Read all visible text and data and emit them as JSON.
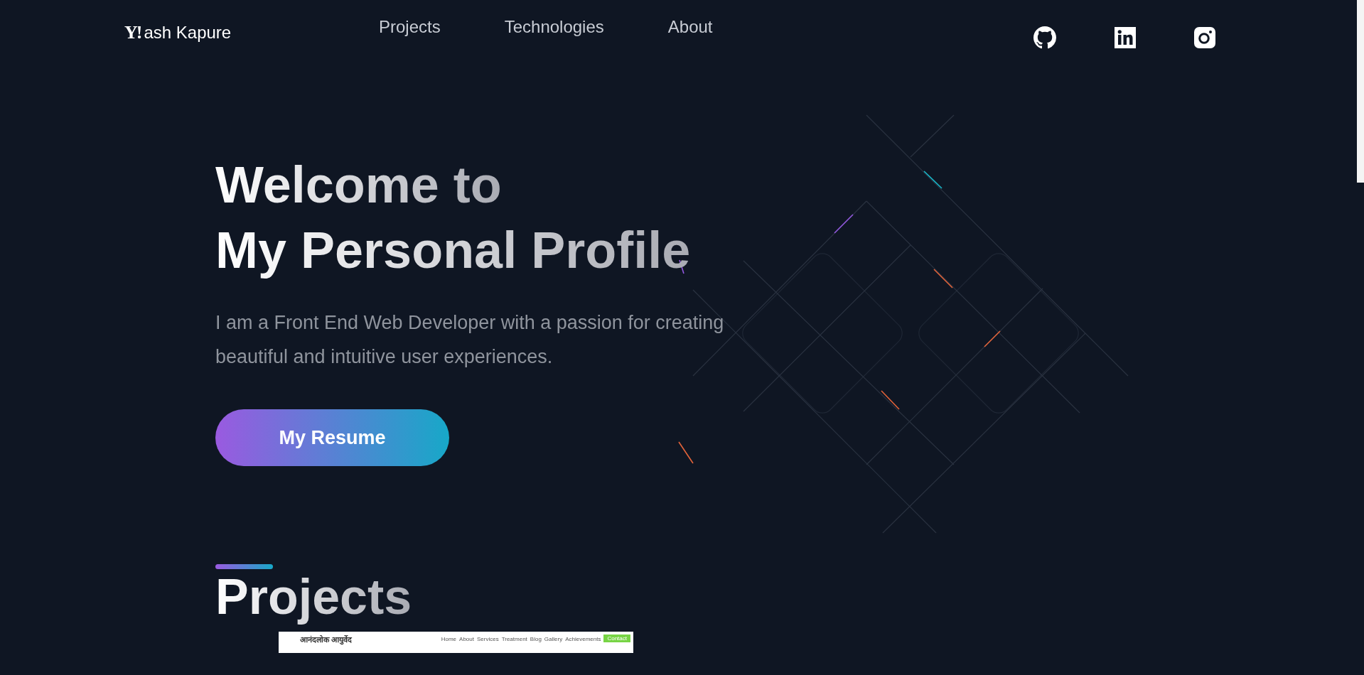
{
  "header": {
    "logo_mark": "Y!",
    "logo_text": "ash Kapure",
    "nav": [
      "Projects",
      "Technologies",
      "About"
    ],
    "social": [
      {
        "kind": "github"
      },
      {
        "kind": "linkedin"
      },
      {
        "kind": "instagram"
      }
    ]
  },
  "hero": {
    "title_lines": [
      "Welcome to",
      "My Personal Profile"
    ],
    "paragraph": "I am a Front End Web Developer with a passion for creating beautiful and intuitive user experiences.",
    "button": "My Resume"
  },
  "projects": {
    "heading": "Projects",
    "cards": [
      {
        "site_title": "आनंदलोक आयुर्वेद",
        "nav": [
          "Home",
          "About",
          "Services",
          "Treatment",
          "Blog",
          "Gallery",
          "Achievements"
        ],
        "cta": "Contact"
      }
    ]
  }
}
